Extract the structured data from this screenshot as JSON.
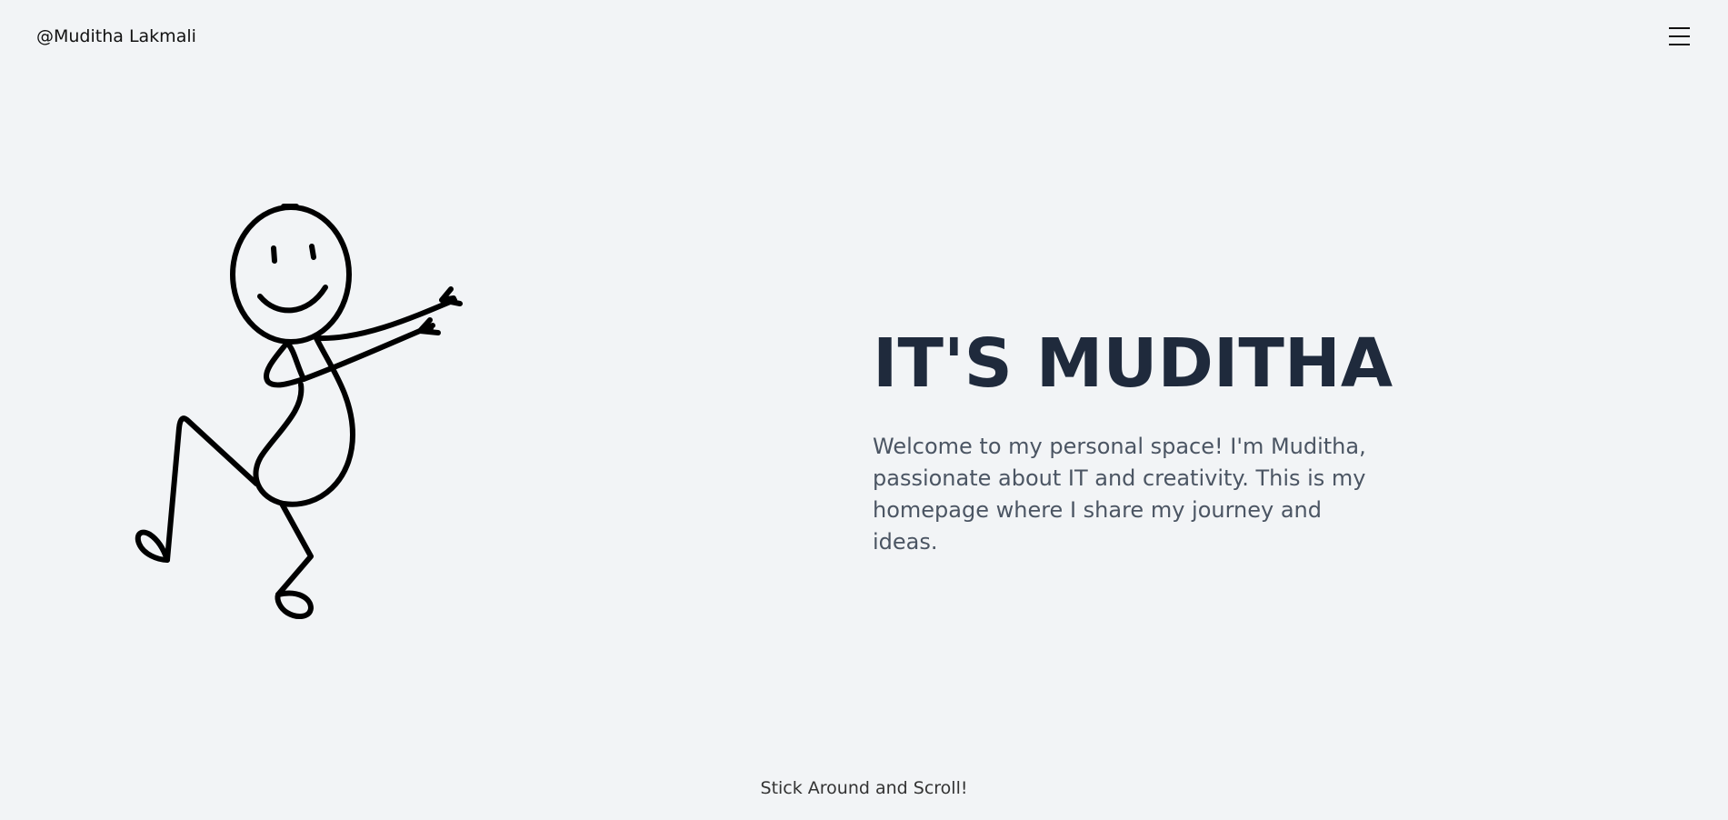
{
  "header": {
    "brand": "@Muditha Lakmali",
    "menu_icon": "hamburger-menu-icon"
  },
  "hero": {
    "illustration_icon": "stick-figure-icon",
    "title": "IT'S MUDITHA",
    "description": "Welcome to my personal space! I'm Muditha, passionate about IT and creativity. This is my homepage where I share my journey and ideas."
  },
  "footer": {
    "scroll_hint": "Stick Around and Scroll!"
  },
  "colors": {
    "background": "#f2f4f6",
    "title": "#1f2a3c",
    "body_text": "#4b5563",
    "line_art": "#000000"
  }
}
